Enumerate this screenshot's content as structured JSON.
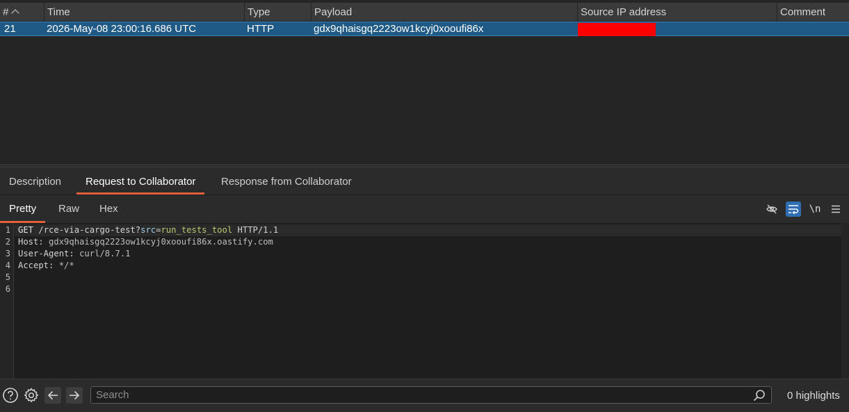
{
  "table": {
    "columns": {
      "num": "#",
      "time": "Time",
      "type": "Type",
      "payload": "Payload",
      "source_ip": "Source IP address",
      "comment": "Comment"
    },
    "rows": [
      {
        "num": "21",
        "time": "2026-May-08 23:00:16.686 UTC",
        "type": "HTTP",
        "payload": "gdx9qhaisgq2223ow1kcyj0xooufi86x",
        "source_ip": "",
        "comment": ""
      }
    ]
  },
  "detail_tabs": [
    "Description",
    "Request to Collaborator",
    "Response from Collaborator"
  ],
  "view_tabs": [
    "Pretty",
    "Raw",
    "Hex"
  ],
  "toolbar": {
    "newline_label": "\\n"
  },
  "request": {
    "line_numbers": [
      "1",
      "2",
      "3",
      "4",
      "5",
      "6"
    ],
    "request_line": {
      "method": "GET",
      "path": "/rce-via-cargo-test?",
      "param": "src",
      "eq": "=",
      "value": "run_tests_tool",
      "protocol": " HTTP/1.1"
    },
    "headers": [
      {
        "name": "Host:",
        "value": " gdx9qhaisgq2223ow1kcyj0xooufi86x.oastify.com"
      },
      {
        "name": "User-Agent:",
        "value": " curl/8.7.1"
      },
      {
        "name": "Accept:",
        "value": " */*"
      }
    ]
  },
  "bottom": {
    "search_placeholder": "Search",
    "highlights": "0 highlights"
  },
  "colors": {
    "accent": "#e2603a",
    "selection": "#1f5a87",
    "redaction": "#ff0000",
    "toggle_on": "#2f6fb1"
  },
  "icons": [
    "sort-ascending-icon",
    "hide-non-printing-icon",
    "word-wrap-icon",
    "menu-icon",
    "help-icon",
    "settings-icon",
    "arrow-left-icon",
    "arrow-right-icon",
    "search-icon"
  ]
}
